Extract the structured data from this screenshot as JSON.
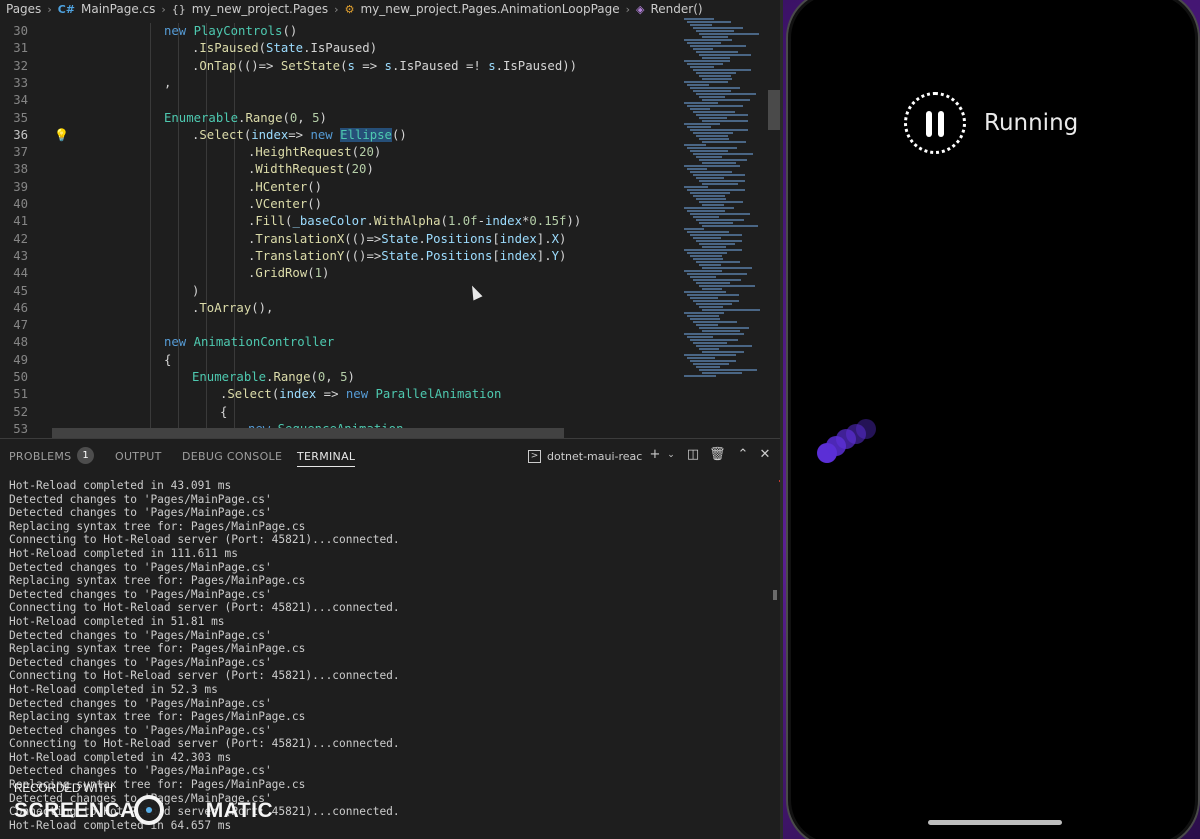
{
  "breadcrumb": {
    "items": [
      {
        "label": "Pages",
        "icon": ""
      },
      {
        "label": "MainPage.cs",
        "icon": "csharp-file-icon"
      },
      {
        "label": "my_new_project.Pages",
        "icon": "namespace-icon"
      },
      {
        "label": "my_new_project.Pages.AnimationLoopPage",
        "icon": "class-icon"
      },
      {
        "label": "Render()",
        "icon": "method-icon"
      }
    ]
  },
  "editor": {
    "current_line": 36,
    "lines": [
      {
        "n": 30,
        "text": "new PlayControls()"
      },
      {
        "n": 31,
        "text": ".IsPaused(State.IsPaused)"
      },
      {
        "n": 32,
        "text": ".OnTap(()=> SetState(s => s.IsPaused =! s.IsPaused))"
      },
      {
        "n": 33,
        "text": ","
      },
      {
        "n": 34,
        "text": ""
      },
      {
        "n": 35,
        "text": "Enumerable.Range(0, 5)"
      },
      {
        "n": 36,
        "text": ".Select(index=> new Ellipse()"
      },
      {
        "n": 37,
        "text": ".HeightRequest(20)"
      },
      {
        "n": 38,
        "text": ".WidthRequest(20)"
      },
      {
        "n": 39,
        "text": ".HCenter()"
      },
      {
        "n": 40,
        "text": ".VCenter()"
      },
      {
        "n": 41,
        "text": ".Fill(_baseColor.WithAlpha(1.0f-index*0.15f))"
      },
      {
        "n": 42,
        "text": ".TranslationX(()=>State.Positions[index].X)"
      },
      {
        "n": 43,
        "text": ".TranslationY(()=>State.Positions[index].Y)"
      },
      {
        "n": 44,
        "text": ".GridRow(1)"
      },
      {
        "n": 45,
        "text": ")"
      },
      {
        "n": 46,
        "text": ".ToArray(),"
      },
      {
        "n": 47,
        "text": ""
      },
      {
        "n": 48,
        "text": "new AnimationController"
      },
      {
        "n": 49,
        "text": "{"
      },
      {
        "n": 50,
        "text": "Enumerable.Range(0, 5)"
      },
      {
        "n": 51,
        "text": ".Select(index => new ParallelAnimation"
      },
      {
        "n": 52,
        "text": "{"
      },
      {
        "n": 53,
        "text": "new SequenceAnimation"
      }
    ]
  },
  "panel": {
    "tabs": [
      {
        "label": "PROBLEMS",
        "active": false
      },
      {
        "label": "OUTPUT",
        "active": false
      },
      {
        "label": "DEBUG CONSOLE",
        "active": false
      },
      {
        "label": "TERMINAL",
        "active": true
      }
    ],
    "problems_count": "1",
    "terminal_name": "dotnet-maui-reac",
    "terminal_lines": [
      "Hot-Reload completed in 43.091 ms",
      "Detected changes to 'Pages/MainPage.cs'",
      "Detected changes to 'Pages/MainPage.cs'",
      "Replacing syntax tree for: Pages/MainPage.cs",
      "Connecting to Hot-Reload server (Port: 45821)...connected.",
      "Hot-Reload completed in 111.611 ms",
      "Detected changes to 'Pages/MainPage.cs'",
      "Replacing syntax tree for: Pages/MainPage.cs",
      "Detected changes to 'Pages/MainPage.cs'",
      "Connecting to Hot-Reload server (Port: 45821)...connected.",
      "Hot-Reload completed in 51.81 ms",
      "Detected changes to 'Pages/MainPage.cs'",
      "Replacing syntax tree for: Pages/MainPage.cs",
      "Detected changes to 'Pages/MainPage.cs'",
      "Connecting to Hot-Reload server (Port: 45821)...connected.",
      "Hot-Reload completed in 52.3 ms",
      "Detected changes to 'Pages/MainPage.cs'",
      "Replacing syntax tree for: Pages/MainPage.cs",
      "Detected changes to 'Pages/MainPage.cs'",
      "Connecting to Hot-Reload server (Port: 45821)...connected.",
      "Hot-Reload completed in 42.303 ms",
      "Detected changes to 'Pages/MainPage.cs'",
      "Replacing syntax tree for: Pages/MainPage.cs",
      "Detected changes to 'Pages/MainPage.cs'",
      "Connecting to Hot-Reload server (Port: 45821)...connected.",
      "Hot-Reload completed in 64.657 ms"
    ]
  },
  "watermark": {
    "line1": "RECORDED WITH",
    "line2a": "SCREENCAST",
    "line2b": "MATIC"
  },
  "app": {
    "status": "Running",
    "ball_color": "#5b2fd6"
  }
}
